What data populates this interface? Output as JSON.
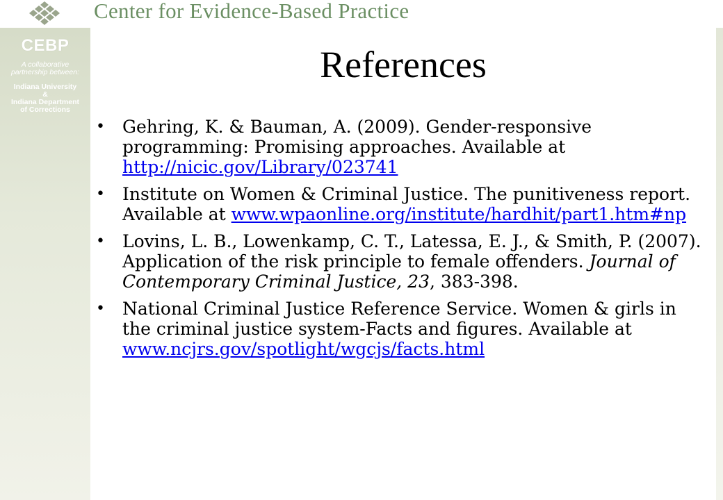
{
  "header": {
    "title": "Center for Evidence-Based Practice",
    "logo": "diamond-grid-logo"
  },
  "sidebar": {
    "acronym": "CEBP",
    "tagline_1": "A collaborative",
    "tagline_2": "partnership between:",
    "partner_1": "Indiana University",
    "partner_amp": "&",
    "partner_2a": "Indiana Department",
    "partner_2b": "of Corrections"
  },
  "slide": {
    "title": "References",
    "references": [
      {
        "text": "Gehring, K. & Bauman, A. (2009). Gender-responsive programming: Promising approaches. Available at ",
        "link": "http://nicic.gov/Library/023741"
      },
      {
        "text": "Institute on Women & Criminal Justice. The punitiveness report. Available at ",
        "link": "www.wpaonline.org/institute/hardhit/part1.htm#np"
      },
      {
        "text_before": "Lovins, L. B., Lowenkamp, C. T., Latessa, E. J., & Smith, P. (2007). Application of the risk principle to female offenders. ",
        "italic": "Journal of Contemporary Criminal Justice, 23",
        "text_after": ", 383-398."
      },
      {
        "text": "National Criminal Justice Reference Service. Women & girls in the criminal justice system-Facts and figures. Available at ",
        "link": "www.ncjrs.gov/spotlight/wgcjs/facts.html"
      }
    ]
  },
  "colors": {
    "header_text": "#6b8f63",
    "sidebar_bg": "#dde2d0",
    "link": "#0000ee"
  }
}
